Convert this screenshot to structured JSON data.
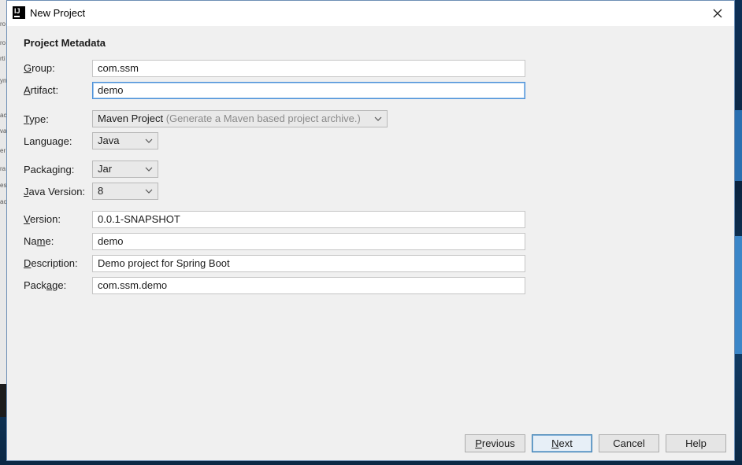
{
  "window": {
    "title": "New Project"
  },
  "section_title": "Project Metadata",
  "form": {
    "group": {
      "label_ul": "G",
      "label_rest": "roup:",
      "value": "com.ssm"
    },
    "artifact": {
      "label_ul": "A",
      "label_rest": "rtifact:",
      "value": "demo"
    },
    "type": {
      "label_ul": "T",
      "label_rest": "ype:",
      "value": "Maven Project",
      "hint": "(Generate a Maven based project archive.)"
    },
    "language": {
      "label_pre": "Lan",
      "label_ul": "g",
      "label_rest": "uage:",
      "value": "Java"
    },
    "packaging": {
      "label_pre": "Packa",
      "label_ul": "g",
      "label_rest": "ing:",
      "value": "Jar"
    },
    "java_version": {
      "label_ul": "J",
      "label_rest": "ava Version:",
      "value": "8"
    },
    "version": {
      "label_ul": "V",
      "label_rest": "ersion:",
      "value": "0.0.1-SNAPSHOT"
    },
    "name": {
      "label_pre": "Na",
      "label_ul": "m",
      "label_rest": "e:",
      "value": "demo"
    },
    "description": {
      "label_ul": "D",
      "label_rest": "escription:",
      "value": "Demo project for Spring Boot"
    },
    "package": {
      "label_pre": "Pack",
      "label_ul": "a",
      "label_rest": "ge:",
      "value": "com.ssm.demo"
    }
  },
  "buttons": {
    "previous": {
      "ul": "P",
      "rest": "revious"
    },
    "next": {
      "ul": "N",
      "rest": "ext"
    },
    "cancel": "Cancel",
    "help": "Help"
  },
  "background_app": {
    "fragments": [
      "ro",
      "ro",
      "rti",
      "yn",
      "ac",
      "va",
      "er",
      "ra",
      "es",
      "ac"
    ]
  },
  "colors": {
    "focus_border": "#4a90d9",
    "dialog_bg": "#f0f0f0",
    "primary_button_border": "#3c7fb1"
  }
}
